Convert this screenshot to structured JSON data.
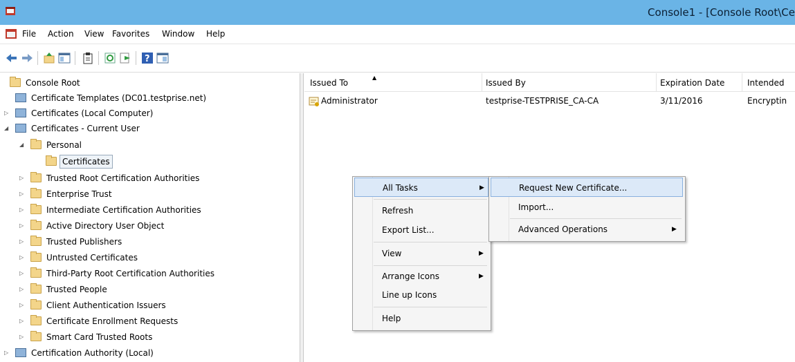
{
  "window": {
    "title": "Console1 - [Console Root\\Ce"
  },
  "menu": [
    "File",
    "Action",
    "View",
    "Favorites",
    "Window",
    "Help"
  ],
  "toolbar_icons": [
    "back-icon",
    "forward-icon",
    "up-folder-icon",
    "show-hide-tree-icon",
    "clipboard-icon",
    "refresh-icon",
    "export-icon",
    "help-icon",
    "properties-icon"
  ],
  "tree": {
    "root": "Console Root",
    "items": [
      "Certificate Templates (DC01.testprise.net)",
      "Certificates (Local Computer)",
      "Certificates - Current User",
      "Personal",
      "Certificates",
      "Trusted Root Certification Authorities",
      "Enterprise Trust",
      "Intermediate Certification Authorities",
      "Active Directory User Object",
      "Trusted Publishers",
      "Untrusted Certificates",
      "Third-Party Root Certification Authorities",
      "Trusted People",
      "Client Authentication Issuers",
      "Certificate Enrollment Requests",
      "Smart Card Trusted Roots",
      "Certification Authority (Local)"
    ]
  },
  "list": {
    "columns": [
      "Issued To",
      "Issued By",
      "Expiration Date",
      "Intended"
    ],
    "rows": [
      {
        "issued_to": "Administrator",
        "issued_by": "testprise-TESTPRISE_CA-CA",
        "expiration": "3/11/2016",
        "intended": "Encryptin"
      }
    ]
  },
  "context_menu": {
    "items": [
      "All Tasks",
      "Refresh",
      "Export List...",
      "View",
      "Arrange Icons",
      "Line up Icons",
      "Help"
    ]
  },
  "submenu": {
    "items": [
      "Request New Certificate...",
      "Import...",
      "Advanced Operations"
    ]
  },
  "colors": {
    "titlebar": "#6ab4e6",
    "highlight": "#dce9f8",
    "highlight_border": "#88b0de",
    "folder": "#f3d58a"
  }
}
